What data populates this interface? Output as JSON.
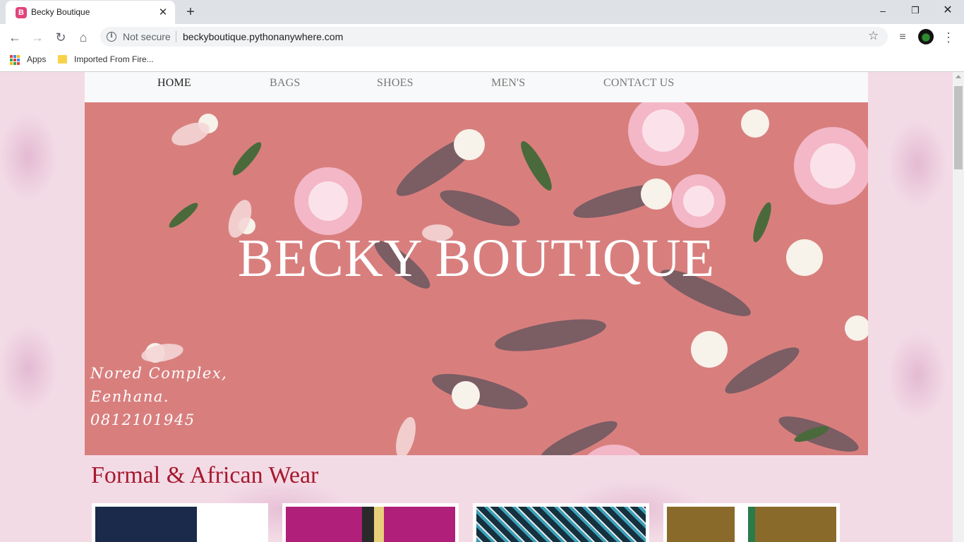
{
  "browser": {
    "tab_title": "Becky Boutique",
    "tab_favicon_letter": "B",
    "security_label": "Not secure",
    "url": "beckyboutique.pythonanywhere.com",
    "bookmarks": [
      {
        "label": "Apps"
      },
      {
        "label": "Imported From Fire..."
      }
    ]
  },
  "nav": {
    "items": [
      {
        "label": "HOME",
        "active": true
      },
      {
        "label": "BAGS"
      },
      {
        "label": "SHOES"
      },
      {
        "label": "MEN'S"
      },
      {
        "label": "CONTACT US"
      }
    ]
  },
  "hero": {
    "title": "BECKY BOUTIQUE",
    "address_lines": [
      "Nored Complex,",
      "Eenhana.",
      "0812101945"
    ]
  },
  "section": {
    "title": "Formal & African Wear"
  },
  "products": [
    {
      "name": "navy-shirt-thumbnail",
      "color": "#1b2a4a"
    },
    {
      "name": "magenta-print-dress-thumbnail",
      "color": "#b0207a"
    },
    {
      "name": "floral-print-shirt-thumbnail",
      "color": "#15303e"
    },
    {
      "name": "olive-vest-thumbnail",
      "color": "#8a6a2a"
    }
  ],
  "colors": {
    "brand_red": "#a6192e",
    "hero_bg": "#d87f7e",
    "page_bg": "#f3dbe6"
  }
}
